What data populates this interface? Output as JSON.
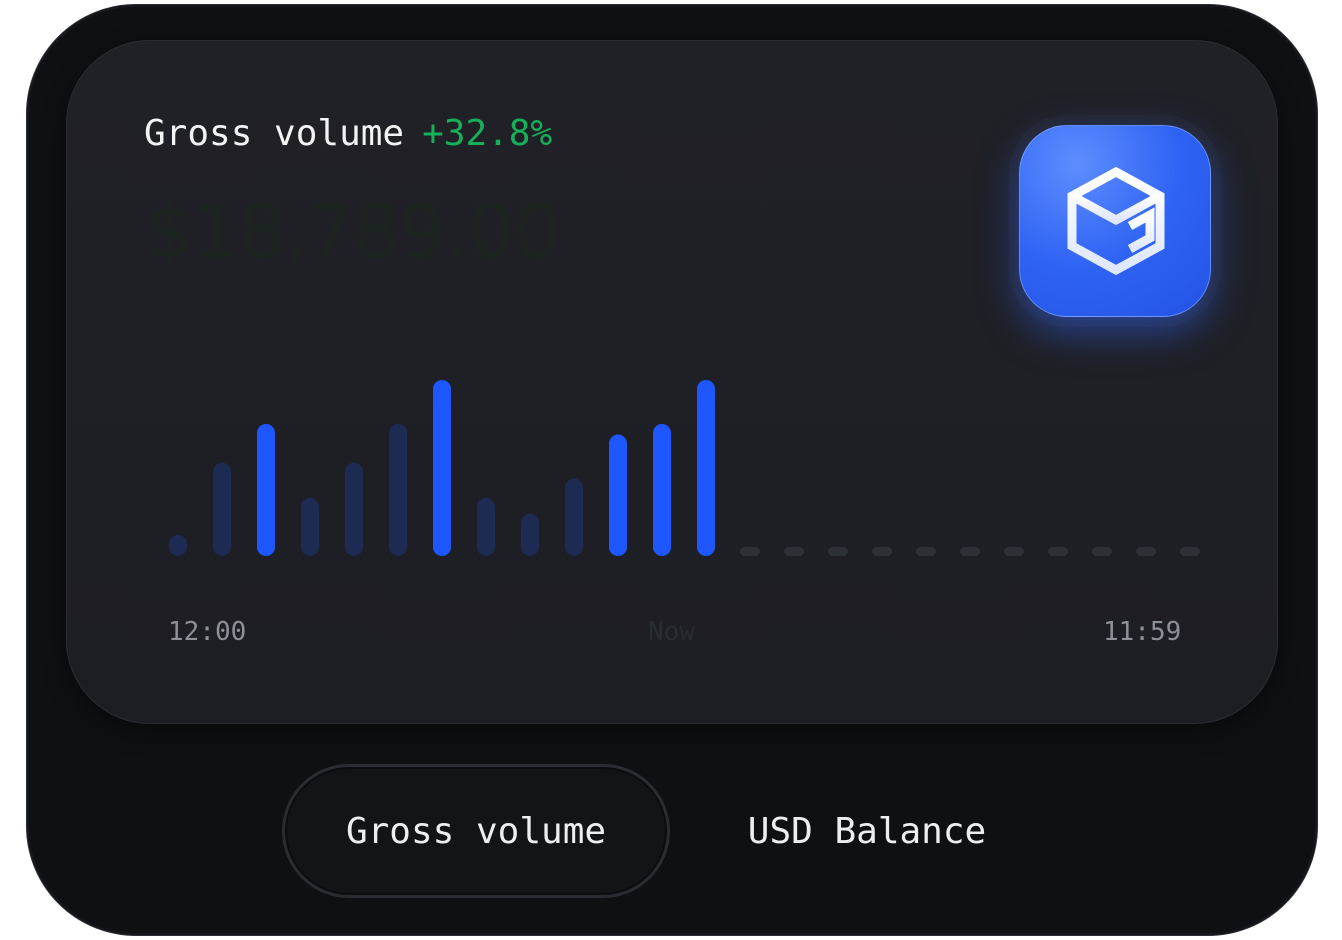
{
  "card": {
    "title": "Gross volume",
    "change": "+32.8%",
    "amount": "$18,789.00"
  },
  "axis": {
    "start": "12:00",
    "mid": "Now",
    "end": "11:59"
  },
  "tabs": [
    {
      "label": "Gross volume",
      "active": true
    },
    {
      "label": "USD Balance",
      "active": false
    }
  ],
  "icons": {
    "app": "cube-logo-icon"
  },
  "colors": {
    "accent": "#1f57ff",
    "positive": "#17b05a",
    "muted_bar": "#1d2a52",
    "placeholder": "#2e3038"
  },
  "chart_data": {
    "type": "bar",
    "bars": [
      {
        "value": 0.12,
        "highlight": false
      },
      {
        "value": 0.53,
        "highlight": false
      },
      {
        "value": 0.75,
        "highlight": true
      },
      {
        "value": 0.33,
        "highlight": false
      },
      {
        "value": 0.53,
        "highlight": false
      },
      {
        "value": 0.75,
        "highlight": false
      },
      {
        "value": 1.0,
        "highlight": true
      },
      {
        "value": 0.33,
        "highlight": false
      },
      {
        "value": 0.24,
        "highlight": false
      },
      {
        "value": 0.44,
        "highlight": false
      },
      {
        "value": 0.69,
        "highlight": true
      },
      {
        "value": 0.75,
        "highlight": true
      },
      {
        "value": 1.0,
        "highlight": true
      }
    ],
    "future_slots": 11,
    "ylim": [
      0,
      1
    ]
  }
}
